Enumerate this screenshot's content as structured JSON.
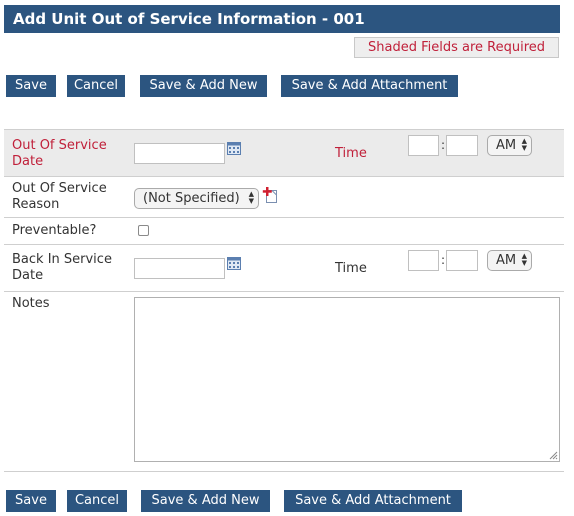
{
  "title": "Add Unit Out of Service Information - 001",
  "required_note": "Shaded Fields are Required",
  "buttons": {
    "save": "Save",
    "cancel": "Cancel",
    "save_add_new": "Save & Add New",
    "save_add_attachment": "Save & Add Attachment"
  },
  "form": {
    "out_of_service_date": {
      "label_line1": "Out Of Service",
      "label_line2": "Date",
      "value": ""
    },
    "out_time": {
      "label": "Time",
      "hour": "",
      "minute": "",
      "ampm": "AM"
    },
    "reason": {
      "label_line1": "Out Of Service",
      "label_line2": "Reason",
      "selected": "(Not Specified)"
    },
    "preventable": {
      "label": "Preventable?",
      "checked": false
    },
    "back_in_service_date": {
      "label_line1": "Back In Service",
      "label_line2": "Date",
      "value": ""
    },
    "back_time": {
      "label": "Time",
      "hour": "",
      "minute": "",
      "ampm": "AM"
    },
    "notes": {
      "label": "Notes",
      "value": ""
    }
  },
  "colors": {
    "header_bg": "#2c5580",
    "required_text": "#c0203a",
    "shaded_row": "#ebebeb"
  },
  "icons": {
    "calendar": "calendar-icon",
    "add": "add-item-icon",
    "select_arrows": "chevron-updown-icon",
    "resize": "resize-grip-icon"
  }
}
